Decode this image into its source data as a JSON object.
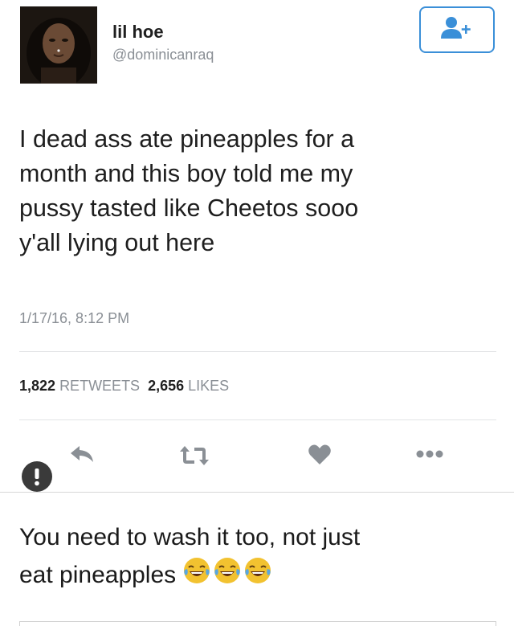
{
  "tweet": {
    "display_name": "lil hoe",
    "handle": "@dominicanraq",
    "text_lines": [
      "I dead ass ate pineapples for a",
      "month and this boy told me my",
      "pussy tasted like Cheetos sooo",
      "y'all lying out here"
    ],
    "timestamp": "1/17/16, 8:12 PM",
    "retweets_count": "1,822",
    "retweets_label": "RETWEETS",
    "likes_count": "2,656",
    "likes_label": "LIKES",
    "icons": {
      "follow": "add-user-icon",
      "reply": "reply-icon",
      "retweet": "retweet-icon",
      "like": "heart-icon",
      "more": "more-icon",
      "alert": "alert-icon"
    }
  },
  "comment": {
    "line1": "You need to wash it too, not just",
    "line2": "eat pineapples",
    "emoji": [
      "face-with-tears-of-joy",
      "face-with-tears-of-joy",
      "face-with-tears-of-joy"
    ]
  },
  "colors": {
    "accent": "#3a8fd8",
    "icon_gray": "#8a8f95",
    "alert_dark": "#3a3a3a"
  }
}
